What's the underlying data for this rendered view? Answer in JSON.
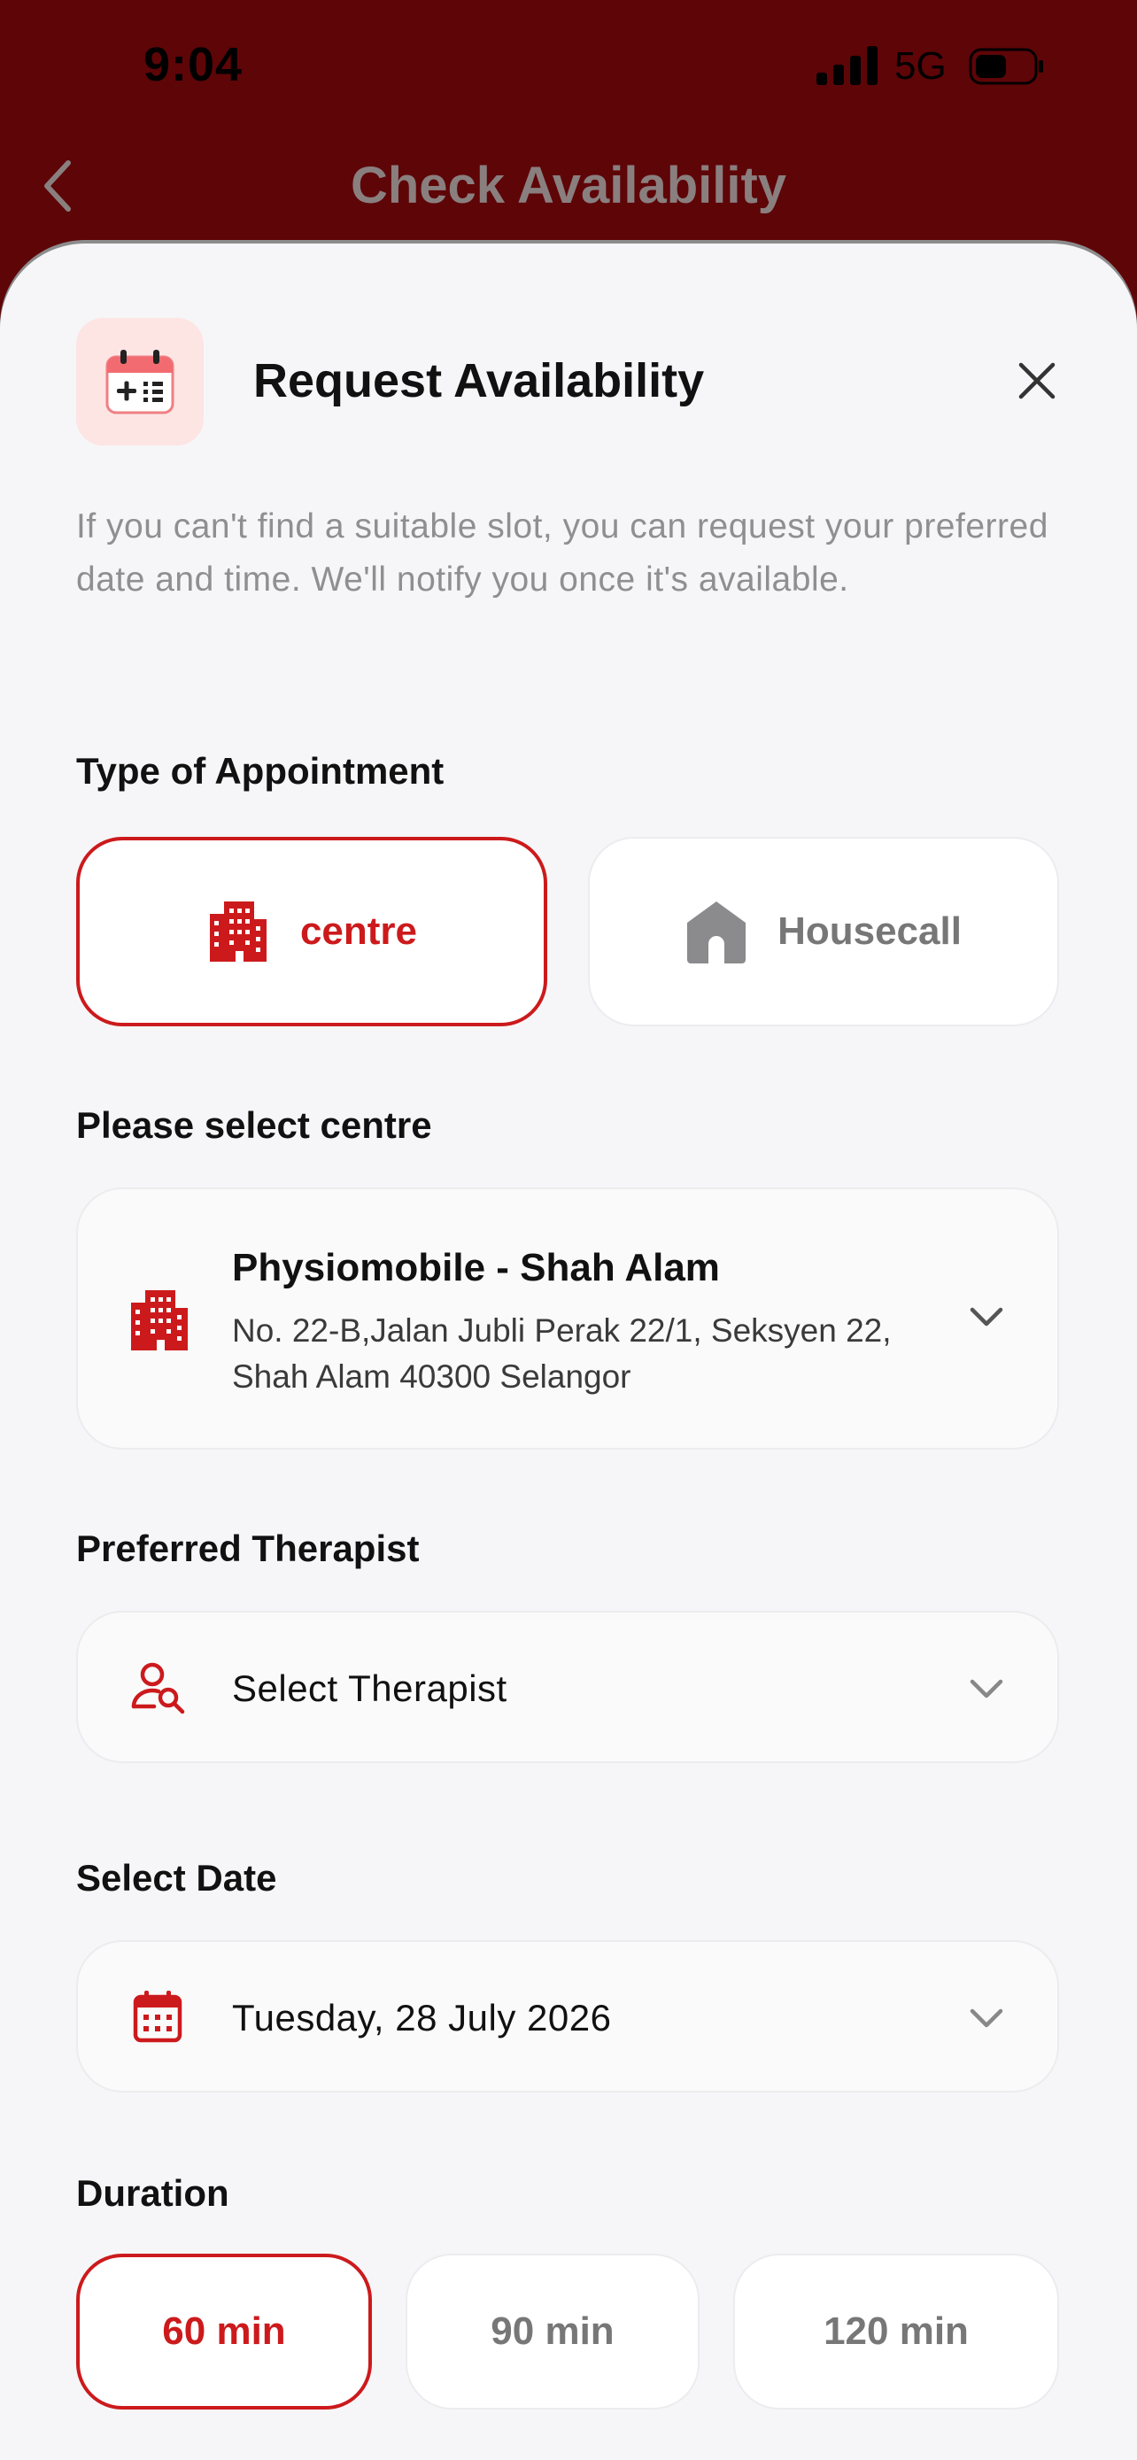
{
  "status_bar": {
    "time": "9:04",
    "network": "5G"
  },
  "nav": {
    "title": "Check Availability"
  },
  "sheet": {
    "title": "Request Availability",
    "description": "If you can't find a suitable slot, you can request your preferred date and time. We'll notify you once it's available."
  },
  "appointment_type": {
    "label": "Type of Appointment",
    "options": [
      {
        "label": "centre",
        "icon": "building-icon",
        "selected": true
      },
      {
        "label": "Housecall",
        "icon": "house-icon",
        "selected": false
      }
    ]
  },
  "centre": {
    "label": "Please select centre",
    "name": "Physiomobile - Shah Alam",
    "address": "No. 22-B,Jalan Jubli Perak 22/1, Seksyen 22, Shah Alam 40300 Selangor"
  },
  "therapist": {
    "label": "Preferred Therapist",
    "value": "Select Therapist"
  },
  "date": {
    "label": "Select Date",
    "value": "Tuesday, 28 July 2026"
  },
  "duration": {
    "label": "Duration",
    "options": [
      {
        "label": "60 min",
        "selected": true
      },
      {
        "label": "90 min",
        "selected": false
      },
      {
        "label": "120 min",
        "selected": false
      }
    ]
  },
  "colors": {
    "brand": "#cc1a1c",
    "header_bg": "#5e0508",
    "sheet_bg": "#f6f6f8",
    "muted_text": "#8f8f93"
  }
}
